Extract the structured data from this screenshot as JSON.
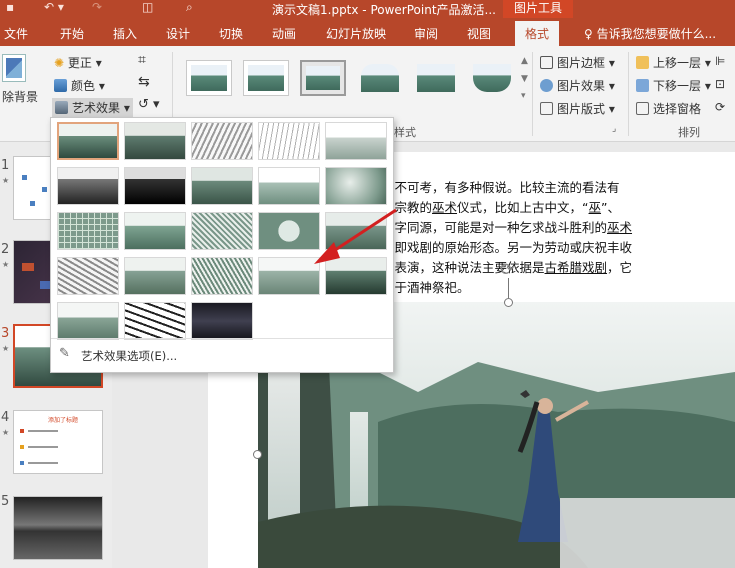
{
  "window": {
    "title": "演示文稿1.pptx - PowerPoint产品激活...",
    "context_tab": "图片工具"
  },
  "tabs": [
    {
      "label": "文件"
    },
    {
      "label": "开始"
    },
    {
      "label": "插入"
    },
    {
      "label": "设计"
    },
    {
      "label": "切换"
    },
    {
      "label": "动画"
    },
    {
      "label": "幻灯片放映"
    },
    {
      "label": "审阅"
    },
    {
      "label": "视图"
    },
    {
      "label": "格式"
    }
  ],
  "tell_me": "告诉我您想要做什么...",
  "ribbon": {
    "remove_bg": "除背景",
    "corrections": "更正",
    "color": "颜色",
    "artistic": "艺术效果",
    "styles_group": "样式",
    "picture_border": "图片边框",
    "picture_effects": "图片效果",
    "picture_layout": "图片版式",
    "bring_forward": "上移一层",
    "send_backward": "下移一层",
    "selection_pane": "选择窗格",
    "arrange_group": "排列"
  },
  "slides": [
    {
      "num": "1"
    },
    {
      "num": "2"
    },
    {
      "num": "3"
    },
    {
      "num": "4",
      "title": "添加了标题"
    },
    {
      "num": "5"
    }
  ],
  "slide_text": [
    {
      "parts": [
        {
          "t": "实不可考，有多种假说。比较主流的看法有"
        }
      ]
    },
    {
      "parts": [
        {
          "t": "始宗教的"
        },
        {
          "t": "巫术",
          "u": true
        },
        {
          "t": "仪式，比如上古中文，“"
        },
        {
          "t": "巫",
          "u": true
        },
        {
          "t": "”、"
        }
      ]
    },
    {
      "parts": [
        {
          "t": "三字同源，可能是对一种乞求战斗胜利的"
        },
        {
          "t": "巫术",
          "u": true
        }
      ]
    },
    {
      "parts": [
        {
          "t": "，即戏剧的原始形态。另一为劳动或庆祝丰收"
        }
      ]
    },
    {
      "parts": [
        {
          "t": "舞表演，这种说法主要依据是"
        },
        {
          "t": "古希腊戏剧",
          "u": true
        },
        {
          "t": "，它"
        }
      ]
    },
    {
      "parts": [
        {
          "t": "源于酒神祭祀。"
        }
      ]
    }
  ],
  "artistic_menu": {
    "option_label": "艺术效果选项(E)...",
    "effects": [
      "none",
      "marker",
      "pencil-grayscale",
      "pencil-sketch",
      "line-drawing",
      "chalk-sketch",
      "paint-strokes",
      "paint-brush",
      "glow-diffused",
      "blur",
      "light-screen",
      "watercolor-sponge",
      "film-grain",
      "mosaic-bubbles",
      "glass",
      "cement",
      "texturizer",
      "crisscross-etching",
      "pastels-smooth",
      "plastic-wrap",
      "cutout",
      "photocopy",
      "glow-edges"
    ],
    "selected_index": 0
  },
  "colors": {
    "brand": "#b7472a",
    "context": "#d24726",
    "arrow": "#d32020"
  }
}
